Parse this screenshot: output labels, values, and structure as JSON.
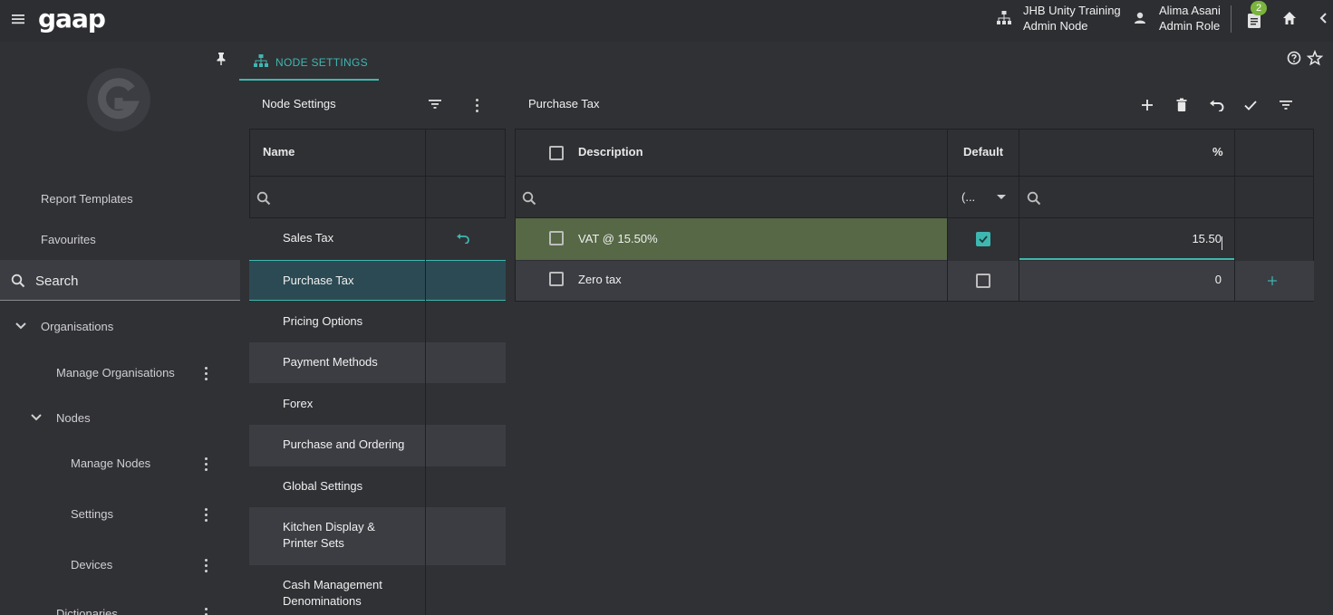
{
  "topbar": {
    "logo": "gaap",
    "node_name": "JHB Unity Training",
    "node_role": "Admin Node",
    "user_name": "Alima Asani",
    "user_role": "Admin Role",
    "notification_count": "2"
  },
  "sidebar": {
    "report_templates": "Report Templates",
    "favourites": "Favourites",
    "search_label": "Search",
    "organisations": "Organisations",
    "manage_organisations": "Manage Organisations",
    "nodes": "Nodes",
    "manage_nodes": "Manage Nodes",
    "settings": "Settings",
    "devices": "Devices",
    "dictionaries": "Dictionaries"
  },
  "tab": {
    "label": "NODE SETTINGS"
  },
  "left_panel": {
    "title": "Node Settings",
    "column_name": "Name",
    "rows": [
      {
        "label": "Sales Tax"
      },
      {
        "label": "Purchase Tax"
      },
      {
        "label": "Pricing Options"
      },
      {
        "label": "Payment Methods"
      },
      {
        "label": "Forex"
      },
      {
        "label": "Purchase and Ordering"
      },
      {
        "label": "Global Settings"
      },
      {
        "label": "Kitchen Display &",
        "label2": "Printer Sets"
      },
      {
        "label": "Cash Management",
        "label2": "Denominations"
      }
    ]
  },
  "right_panel": {
    "title": "Purchase Tax",
    "col_description": "Description",
    "col_default": "Default",
    "col_percent": "%",
    "default_filter": "(...",
    "rows": [
      {
        "description": "VAT @ 15.50%",
        "default": true,
        "percent": "15.50"
      },
      {
        "description": "Zero tax",
        "default": false,
        "percent": "0"
      }
    ]
  },
  "colors": {
    "accent": "#3eb7b0",
    "selected_row": "#566845",
    "background": "#303135"
  }
}
